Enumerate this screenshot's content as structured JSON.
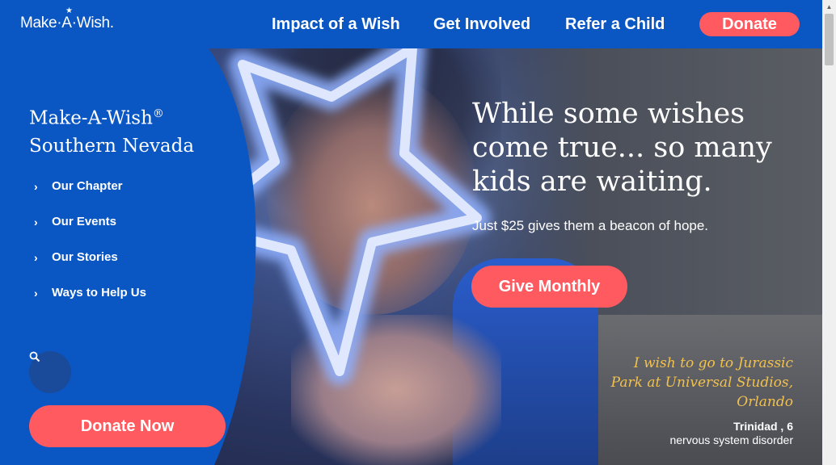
{
  "header": {
    "logo_text": "Make·A·Wish.",
    "nav": [
      "Impact of a Wish",
      "Get Involved",
      "Refer a Child"
    ],
    "donate_label": "Donate"
  },
  "sidebar": {
    "title_line1": "Make-A-Wish",
    "title_mark": "®",
    "title_line2": "Southern Nevada",
    "items": [
      {
        "label": "Our Chapter"
      },
      {
        "label": "Our Events"
      },
      {
        "label": "Our Stories"
      },
      {
        "label": "Ways to Help Us"
      }
    ],
    "donate_now_label": "Donate Now"
  },
  "hero": {
    "headline": "While some wishes come true... so many kids are waiting.",
    "subhead": "Just $25 gives them a beacon of hope.",
    "cta_label": "Give Monthly",
    "quote": "I wish to go to Jurassic Park at Universal Studios, Orlando",
    "wisher_name": "Trinidad , 6",
    "wisher_condition": "nervous system disorder"
  },
  "colors": {
    "brand_blue": "#0a57c4",
    "accent_coral": "#ff5a5f",
    "quote_gold": "#f2c14e"
  }
}
